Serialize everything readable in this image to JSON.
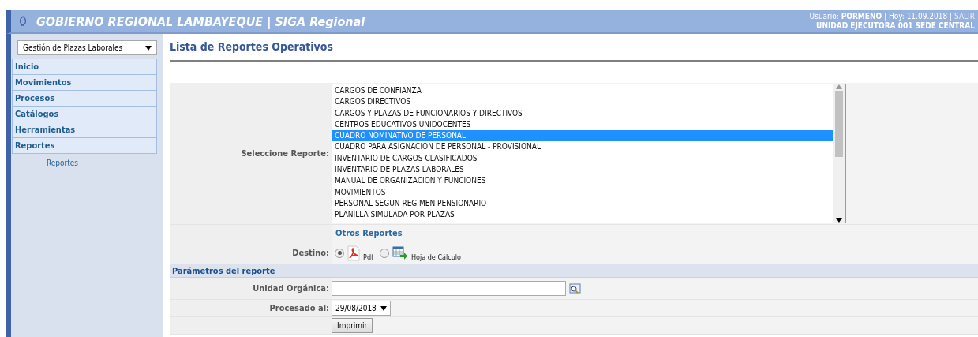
{
  "header": {
    "title": "GOBIERNO REGIONAL LAMBAYEQUE | SIGA Regional",
    "user_line": "Usuario: **PORMENO** | Hoy: 11.09.2018 |",
    "logout": "SALIR",
    "unit": "UNIDAD EJECUTORA 001 SEDE CENTRAL"
  },
  "sidebar": {
    "module_select": "Gestión de Plazas Laborales",
    "items": [
      {
        "label": "Inicio"
      },
      {
        "label": "Movimientos"
      },
      {
        "label": "Procesos"
      },
      {
        "label": "Catálogos"
      },
      {
        "label": "Herramientas"
      },
      {
        "label": "Reportes",
        "children": [
          {
            "label": "Reportes"
          }
        ]
      }
    ]
  },
  "content": {
    "title": "Lista de Reportes Operativos",
    "report_label": "Seleccione Reporte:",
    "reports": [
      {
        "label": "CARGOS DE CONFIANZA",
        "selected": false
      },
      {
        "label": "CARGOS DIRECTIVOS",
        "selected": false
      },
      {
        "label": "CARGOS Y PLAZAS DE FUNCIONARIOS Y DIRECTIVOS",
        "selected": false
      },
      {
        "label": "CENTROS EDUCATIVOS UNIDOCENTES",
        "selected": false
      },
      {
        "label": "CUADRO NOMINATIVO DE PERSONAL",
        "selected": true
      },
      {
        "label": "CUADRO PARA ASIGNACION DE PERSONAL - PROVISIONAL",
        "selected": false
      },
      {
        "label": "INVENTARIO DE CARGOS CLASIFICADOS",
        "selected": false
      },
      {
        "label": "INVENTARIO DE PLAZAS LABORALES",
        "selected": false
      },
      {
        "label": "MANUAL DE ORGANIZACION Y FUNCIONES",
        "selected": false
      },
      {
        "label": "MOVIMIENTOS",
        "selected": false
      },
      {
        "label": "PERSONAL SEGUN REGIMEN PENSIONARIO",
        "selected": false
      },
      {
        "label": "PLANILLA SIMULADA POR PLAZAS",
        "selected": false
      }
    ],
    "other_reports": "Otros Reportes",
    "destination_label": "Destino:",
    "destinations": [
      {
        "label": "Pdf",
        "kind": "pdf",
        "selected": true
      },
      {
        "label": "Hoja de Cálculo",
        "kind": "sheet",
        "selected": false
      }
    ],
    "params_header": "Parámetros del reporte",
    "unit_label": "Unidad Orgánica:",
    "date_label": "Procesado al:",
    "date_value": "29/08/2018",
    "print_button": "Imprimir"
  }
}
